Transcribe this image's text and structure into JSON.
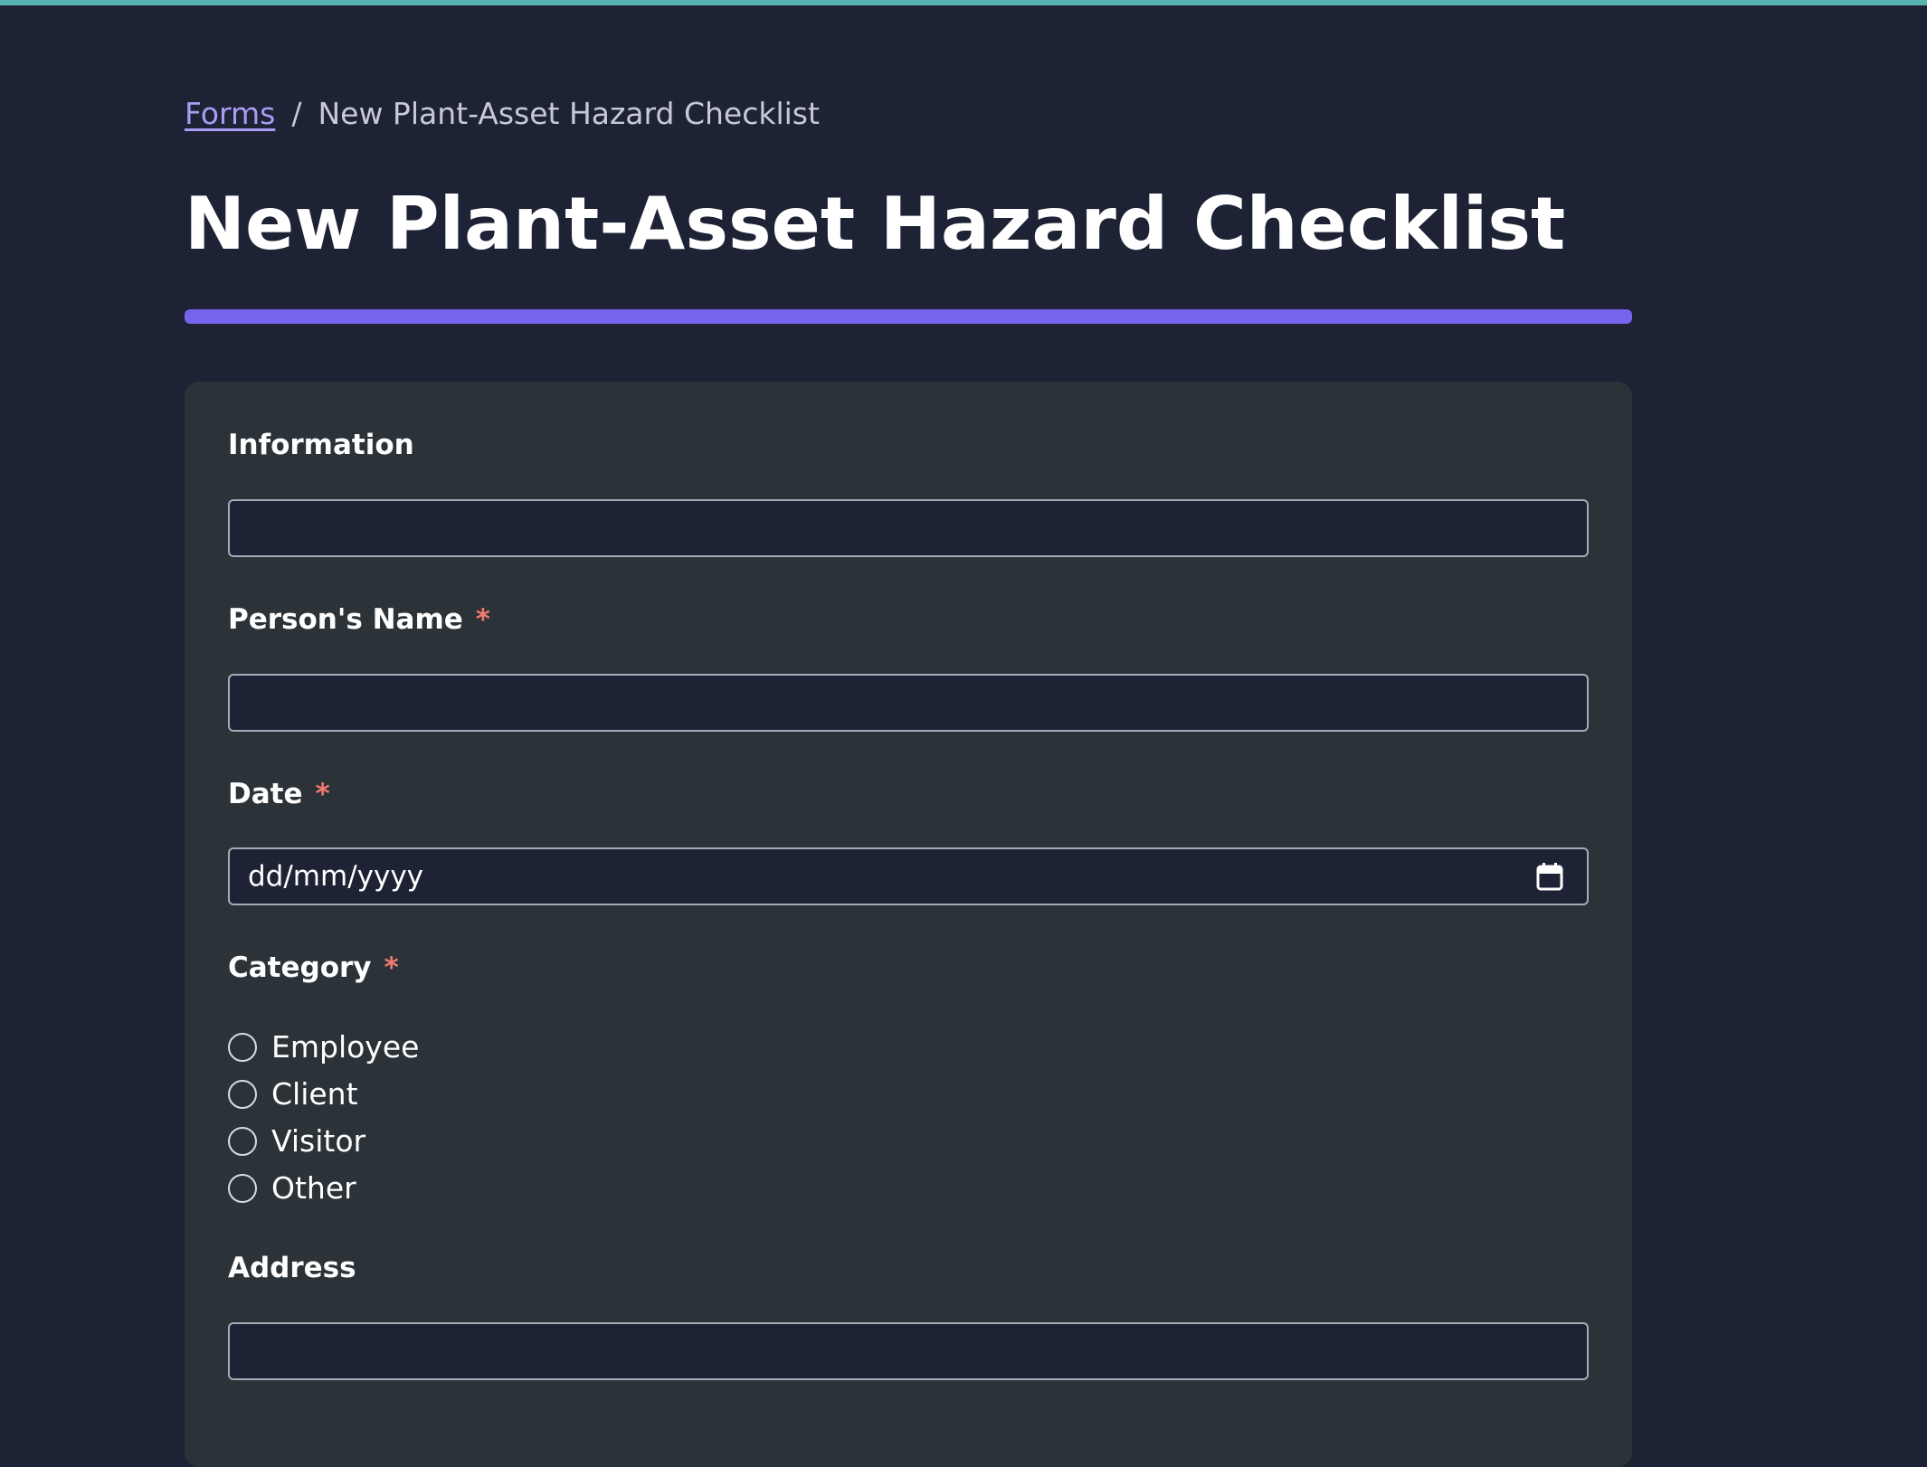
{
  "colors": {
    "background": "#1e2235",
    "top_accent": "#56b3b0",
    "title_bar": "#7663ee",
    "card": "#2c3338",
    "link": "#a79df2",
    "required": "#f07a70"
  },
  "breadcrumb": {
    "link_label": "Forms",
    "separator": "/",
    "current": "New Plant-Asset Hazard Checklist"
  },
  "page": {
    "title": "New Plant-Asset Hazard Checklist"
  },
  "form": {
    "required_mark": "*",
    "information": {
      "label": "Information",
      "value": ""
    },
    "person_name": {
      "label": "Person's Name",
      "value": ""
    },
    "date": {
      "label": "Date",
      "placeholder": "dd/mm/yyyy",
      "icon": "calendar-icon"
    },
    "category": {
      "label": "Category",
      "options": [
        "Employee",
        "Client",
        "Visitor",
        "Other"
      ],
      "selected": null
    },
    "address": {
      "label": "Address",
      "value": ""
    }
  }
}
